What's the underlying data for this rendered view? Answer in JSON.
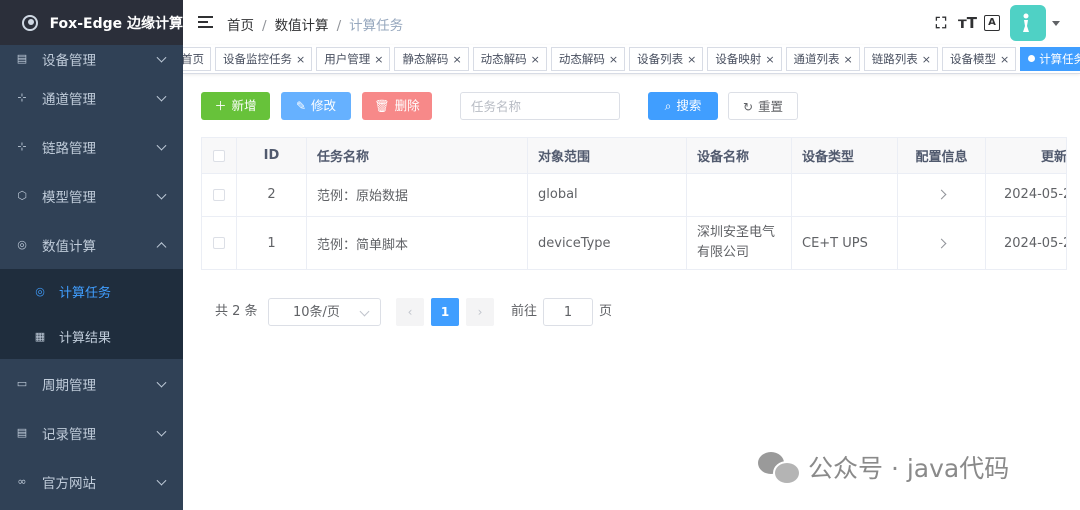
{
  "app": {
    "title": "Fox-Edge 边缘计算"
  },
  "sidebar": {
    "items": [
      {
        "label": "设备管理",
        "icon": "device-icon"
      },
      {
        "label": "通道管理",
        "icon": "channel-icon"
      },
      {
        "label": "链路管理",
        "icon": "link-icon"
      },
      {
        "label": "模型管理",
        "icon": "cube-icon"
      },
      {
        "label": "数值计算",
        "icon": "compute-icon",
        "expanded": true,
        "children": [
          {
            "label": "计算任务",
            "icon": "task-icon",
            "active": true
          },
          {
            "label": "计算结果",
            "icon": "result-icon"
          }
        ]
      },
      {
        "label": "周期管理",
        "icon": "calendar-icon"
      },
      {
        "label": "记录管理",
        "icon": "record-icon"
      },
      {
        "label": "官方网站",
        "icon": "website-icon"
      }
    ]
  },
  "breadcrumb": {
    "items": [
      "首页",
      "数值计算",
      "计算任务"
    ],
    "separator": "/"
  },
  "header_tools": {
    "fullscreen": "⛶",
    "font_size": "тT",
    "translate": "A"
  },
  "tags": {
    "items": [
      "首页",
      "设备监控任务",
      "用户管理",
      "静态解码",
      "动态解码",
      "动态解码",
      "设备列表",
      "设备映射",
      "通道列表",
      "链路列表",
      "设备模型",
      "计算任务"
    ],
    "close": "×",
    "active_index": 11
  },
  "toolbar": {
    "add_label": "新增",
    "edit_label": "修改",
    "delete_label": "删除",
    "search_placeholder": "任务名称",
    "search_label": "搜索",
    "reset_label": "重置"
  },
  "table": {
    "columns": [
      "",
      "ID",
      "任务名称",
      "对象范围",
      "设备名称",
      "设备类型",
      "配置信息",
      "更新时间"
    ],
    "rows": [
      {
        "id": "2",
        "name": "范例：原始数据",
        "scope": "global",
        "device_name": "",
        "device_type": "",
        "updated": "2024-05-2"
      },
      {
        "id": "1",
        "name": "范例：简单脚本",
        "scope": "deviceType",
        "device_name": "深圳安圣电气有限公司",
        "device_type": "CE+T UPS",
        "updated": "2024-05-2"
      }
    ]
  },
  "pagination": {
    "total_text": "共 2 条",
    "page_size": "10条/页",
    "current_page": "1",
    "prev": "‹",
    "next": "›",
    "goto_label": "前往",
    "goto_value": "1",
    "goto_suffix": "页"
  },
  "watermark": {
    "text": "公众号 · java代码"
  },
  "colors": {
    "sidebar": "#304156",
    "primary": "#409eff",
    "success": "#67c23a",
    "danger": "#f78989"
  }
}
